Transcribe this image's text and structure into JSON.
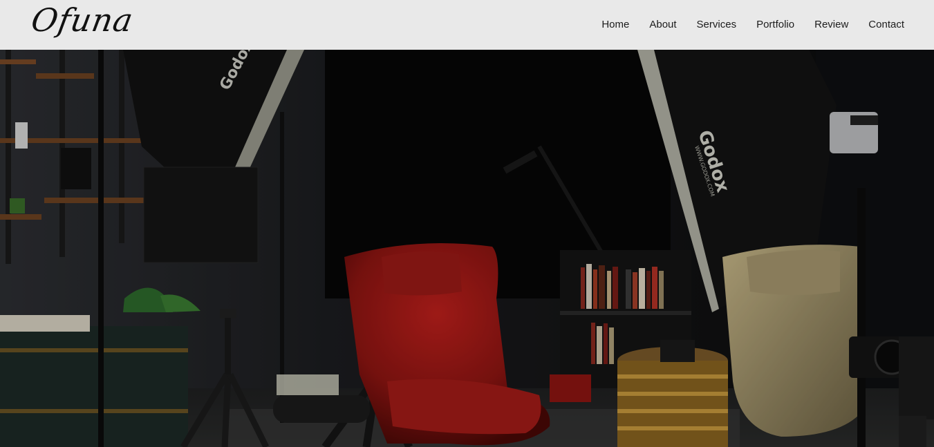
{
  "brand": {
    "logo_text": "Ofuna"
  },
  "nav": {
    "items": [
      {
        "label": "Home"
      },
      {
        "label": "About"
      },
      {
        "label": "Services"
      },
      {
        "label": "Portfolio"
      },
      {
        "label": "Review"
      },
      {
        "label": "Contact"
      }
    ]
  },
  "hero": {
    "softbox_brand_left": "Godox",
    "softbox_brand_right": "Godox",
    "softbox_url": "WWW.GODOX.COM"
  }
}
